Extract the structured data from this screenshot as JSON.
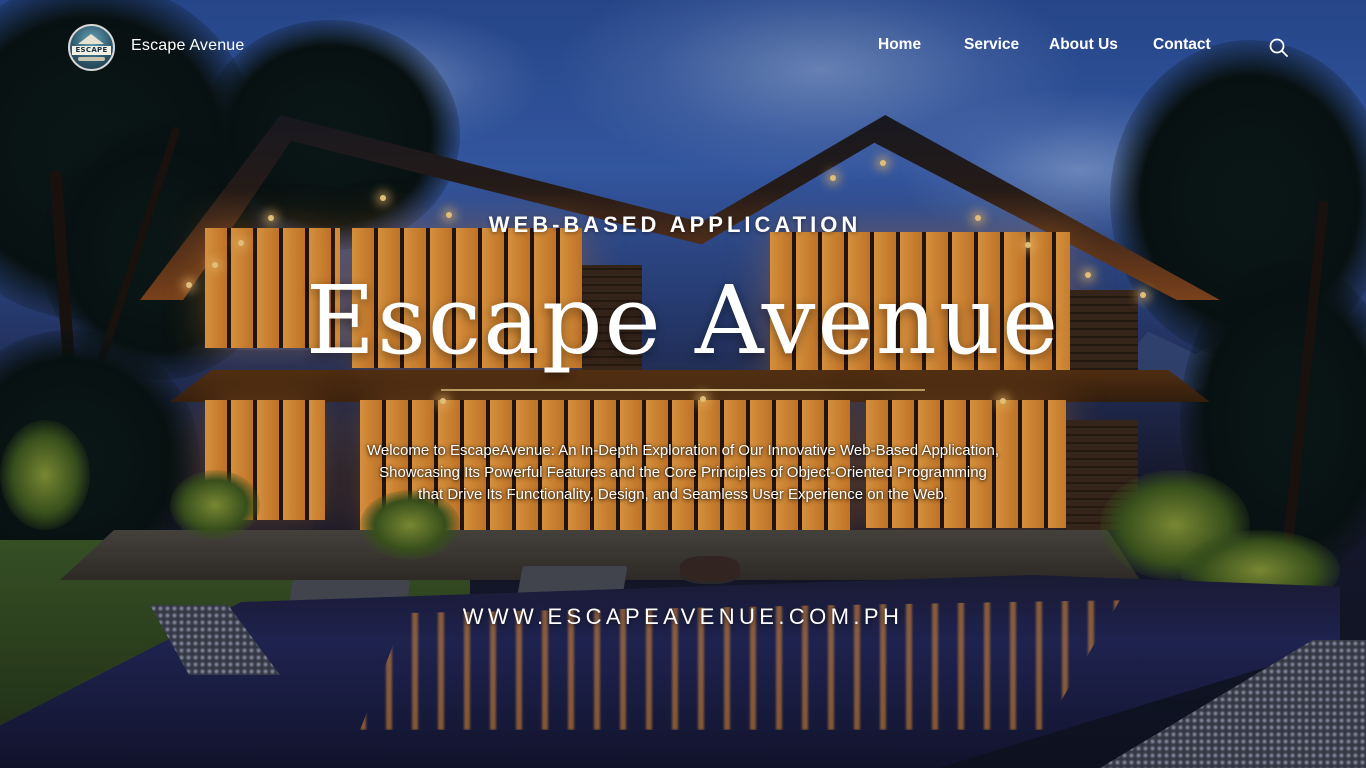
{
  "brand": {
    "logo_text": "ESCAPE",
    "name": "Escape Avenue"
  },
  "nav": {
    "items": [
      {
        "label": "Home"
      },
      {
        "label": "Service"
      },
      {
        "label": "About Us"
      },
      {
        "label": "Contact"
      }
    ],
    "search_icon": "search-icon"
  },
  "hero": {
    "eyebrow": "WEB-BASED APPLICATION",
    "title": "Escape Avenue",
    "description_lines": [
      "Welcome to EscapeAvenue: An In-Depth Exploration of Our Innovative Web-Based Application,",
      "Showcasing Its Powerful Features and the Core Principles of Object-Oriented Programming",
      "that Drive Its Functionality, Design, and Seamless User Experience on the Web."
    ],
    "url": "WWW.ESCAPEAVENUE.COM.PH"
  },
  "colors": {
    "text": "#ffffff",
    "accent_rule": "#d8bf8a",
    "sky": "#3b62b5",
    "warm_light": "#f2a446"
  }
}
